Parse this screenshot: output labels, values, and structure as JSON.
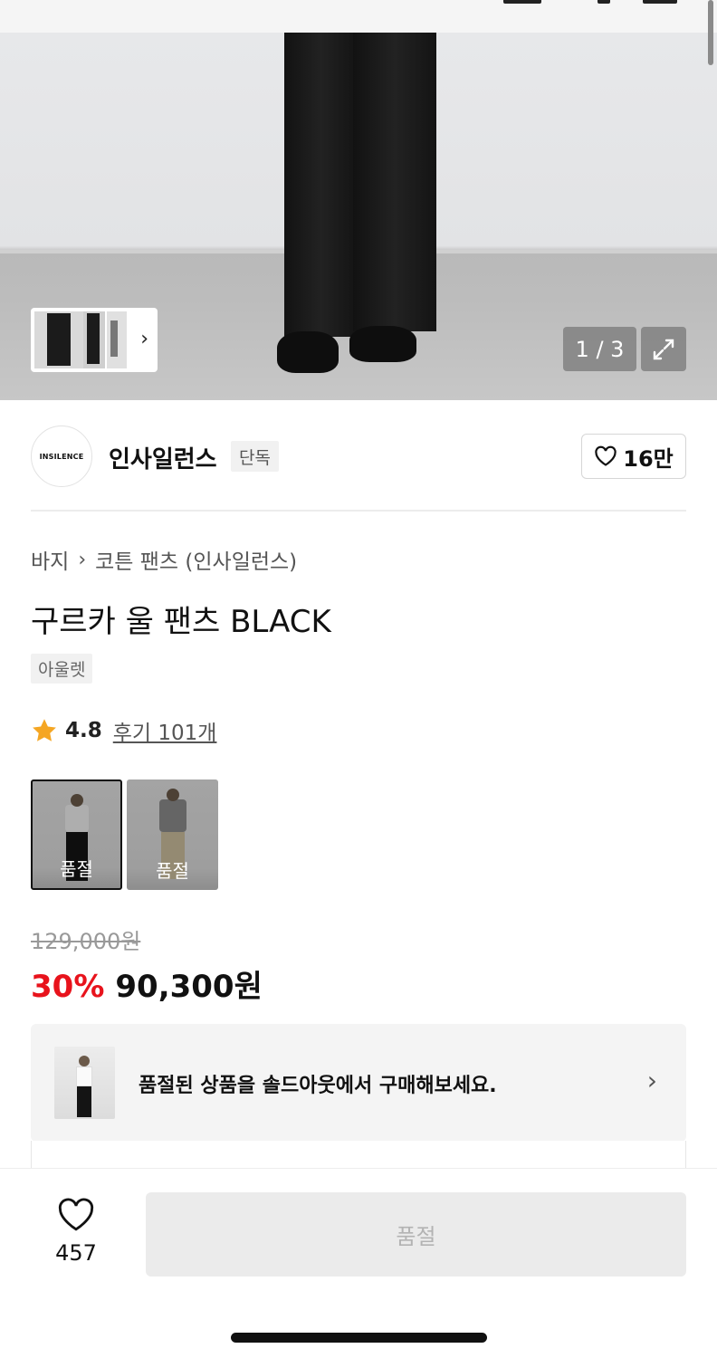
{
  "gallery": {
    "counter": "1 / 3"
  },
  "brand": {
    "logo_text": "INSILENCE",
    "name": "인사일런스",
    "exclusive_label": "단독",
    "like_count": "16만"
  },
  "breadcrumb": {
    "category": "바지",
    "subcategory": "코튼 팬츠 (인사일런스)"
  },
  "product": {
    "title": "구르카 울 팬츠 BLACK",
    "tag": "아울렛",
    "rating": "4.8",
    "reviews": "후기 101개"
  },
  "swatches": [
    {
      "label": "품절",
      "color_name": "black"
    },
    {
      "label": "품절",
      "color_name": "beige"
    }
  ],
  "price": {
    "original": "129,000원",
    "discount": "30%",
    "final": "90,300원"
  },
  "banner": {
    "text": "품절된 상품을 솔드아웃에서 구매해보세요."
  },
  "bottom": {
    "wish_count": "457",
    "buy_label": "품절"
  },
  "colors": {
    "discount": "#e8131c",
    "star": "#f5a623",
    "disabled_button": "#ebebeb"
  }
}
